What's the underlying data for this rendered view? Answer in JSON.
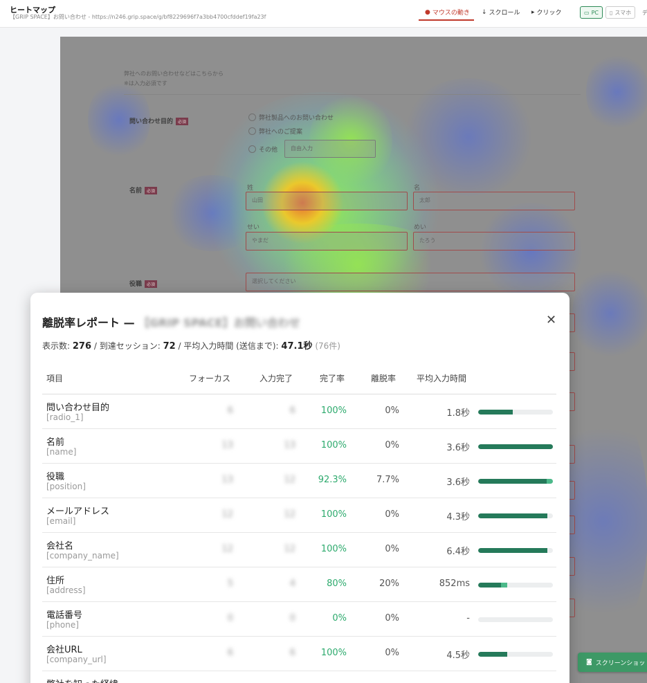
{
  "header": {
    "title": "ヒートマップ",
    "subtitle": "【GRIP SPACE】お問い合わせ - https://n246.grip.space/g/bf8229696f7a3bb4700cfddef19fa23f",
    "modes": [
      {
        "label": "マウスの動き",
        "icon": "fire-icon"
      },
      {
        "label": "スクロール",
        "icon": "arrow-down-icon"
      },
      {
        "label": "クリック",
        "icon": "cursor-icon"
      }
    ],
    "devices": [
      {
        "label": "PC",
        "icon": "monitor-icon"
      },
      {
        "label": "スマホ",
        "icon": "phone-icon"
      }
    ],
    "overflow_label": "デ"
  },
  "form": {
    "intro_line1": "弊社へのお問い合わせなどはこちらから",
    "intro_line2": "※は入力必須です",
    "required_badge": "必須",
    "q1_label": "問い合わせ目的",
    "q1_options": [
      "弊社製品へのお問い合わせ",
      "弊社へのご提案",
      "その他"
    ],
    "q1_other_placeholder": "自由入力",
    "name_label": "名前",
    "sei_label": "姓",
    "mei_label": "名",
    "sei_value": "山田",
    "mei_value": "太郎",
    "sei_kana_label": "せい",
    "mei_kana_label": "めい",
    "sei_kana_value": "やまだ",
    "mei_kana_value": "たろう",
    "position_label": "役職",
    "position_placeholder": "選択してください"
  },
  "screenshot_button": "スクリーンショット",
  "report": {
    "title_prefix": "離脱率レポート —",
    "title_form": "【GRIP SPACE】お問い合わせ",
    "summary": {
      "views_label": "表示数:",
      "views": "276",
      "sessions_label": "/ 到達セッション:",
      "sessions": "72",
      "avg_label": "/ 平均入力時間 (送信まで):",
      "avg": "47.1秒",
      "count": "(76件)"
    },
    "columns": [
      "項目",
      "フォーカス",
      "入力完了",
      "完了率",
      "離脱率",
      "平均入力時間"
    ],
    "rows": [
      {
        "name": "問い合わせ目的",
        "key": "[radio_1]",
        "focus": "6",
        "done": "6",
        "rate": "100%",
        "drop": "0%",
        "time": "1.8秒",
        "bar": 0.46,
        "bar_drop": 0
      },
      {
        "name": "名前",
        "key": "[name]",
        "focus": "13",
        "done": "13",
        "rate": "100%",
        "drop": "0%",
        "time": "3.6秒",
        "bar": 1.0,
        "bar_drop": 0
      },
      {
        "name": "役職",
        "key": "[position]",
        "focus": "13",
        "done": "12",
        "rate": "92.3%",
        "drop": "7.7%",
        "time": "3.6秒",
        "bar": 0.92,
        "bar_drop": 0.08
      },
      {
        "name": "メールアドレス",
        "key": "[email]",
        "focus": "12",
        "done": "12",
        "rate": "100%",
        "drop": "0%",
        "time": "4.3秒",
        "bar": 0.93,
        "bar_drop": 0
      },
      {
        "name": "会社名",
        "key": "[company_name]",
        "focus": "12",
        "done": "12",
        "rate": "100%",
        "drop": "0%",
        "time": "6.4秒",
        "bar": 0.93,
        "bar_drop": 0
      },
      {
        "name": "住所",
        "key": "[address]",
        "focus": "5",
        "done": "4",
        "rate": "80%",
        "drop": "20%",
        "time": "852ms",
        "bar": 0.31,
        "bar_drop": 0.08
      },
      {
        "name": "電話番号",
        "key": "[phone]",
        "focus": "0",
        "done": "0",
        "rate": "0%",
        "drop": "0%",
        "time": "-",
        "bar": 0,
        "bar_drop": 0
      },
      {
        "name": "会社URL",
        "key": "[company_url]",
        "focus": "6",
        "done": "6",
        "rate": "100%",
        "drop": "0%",
        "time": "4.5秒",
        "bar": 0.39,
        "bar_drop": 0
      },
      {
        "name": "弊社を知った経緯",
        "key": "",
        "focus": "",
        "done": "",
        "rate": "",
        "drop": "",
        "time": "",
        "bar": 0,
        "bar_drop": 0
      }
    ]
  }
}
